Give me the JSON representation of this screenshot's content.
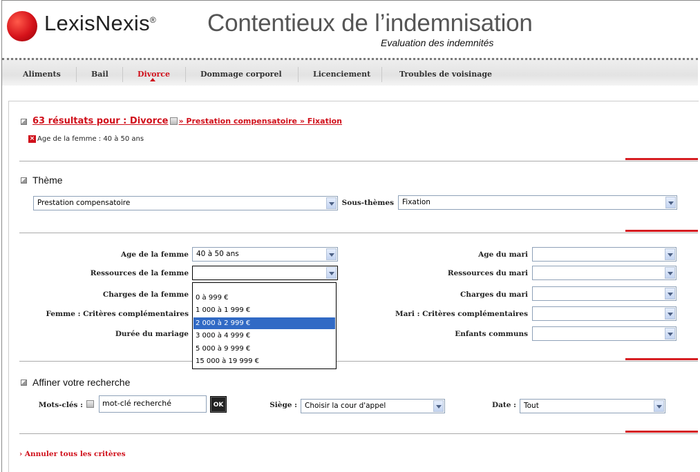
{
  "header": {
    "brand": "LexisNexis",
    "brand_mark": "®",
    "title": "Contentieux de l’indemnisation",
    "subtitle": "Evaluation des indemnités"
  },
  "nav": {
    "tabs": [
      "Aliments",
      "Bail",
      "Divorce",
      "Dommage corporel",
      "Licenciement",
      "Troubles de voisinage"
    ],
    "active": "Divorce"
  },
  "results": {
    "count_text": "63 résultats pour : Divorce",
    "path_text": "» Prestation compensatoire » Fixation",
    "active_filter": "Age de la femme : 40 à 50 ans"
  },
  "theme": {
    "title": "Thème",
    "theme_value": "Prestation compensatoire",
    "subtheme_label": "Sous-thèmes",
    "subtheme_value": "Fixation"
  },
  "criteria": {
    "left": [
      {
        "label": "Age de la femme",
        "value": "40 à 50 ans"
      },
      {
        "label": "Ressources de la femme",
        "value": ""
      },
      {
        "label": "Charges de la femme",
        "value": ""
      },
      {
        "label": "Femme : Critères complémentaires",
        "value": ""
      },
      {
        "label": "Durée du mariage",
        "value": ""
      }
    ],
    "right": [
      {
        "label": "Age du mari",
        "value": ""
      },
      {
        "label": "Ressources du mari",
        "value": ""
      },
      {
        "label": "Charges du mari",
        "value": ""
      },
      {
        "label": "Mari : Critères complémentaires",
        "value": ""
      },
      {
        "label": "Enfants communs",
        "value": ""
      }
    ],
    "open_dropdown": {
      "options": [
        "",
        "0 à 999 €",
        "1 000 à 1 999 €",
        "2 000 à 2 999 €",
        "3 000 à 4 999 €",
        "5 000 à 9 999 €",
        "15 000 à 19 999 €"
      ],
      "highlighted": "2 000 à 2 999 €"
    }
  },
  "refine": {
    "title": "Affiner votre recherche",
    "keywords_label": "Mots-clés :",
    "keywords_value": "mot-clé recherché",
    "ok_label": "OK",
    "court_label": "Siège :",
    "court_value": "Choisir la cour d'appel",
    "date_label": "Date :",
    "date_value": "Tout"
  },
  "footer": {
    "cancel_link": "› Annuler tous les critères"
  },
  "colors": {
    "accent_red": "#d0101b",
    "selection_blue": "#316ac5"
  }
}
